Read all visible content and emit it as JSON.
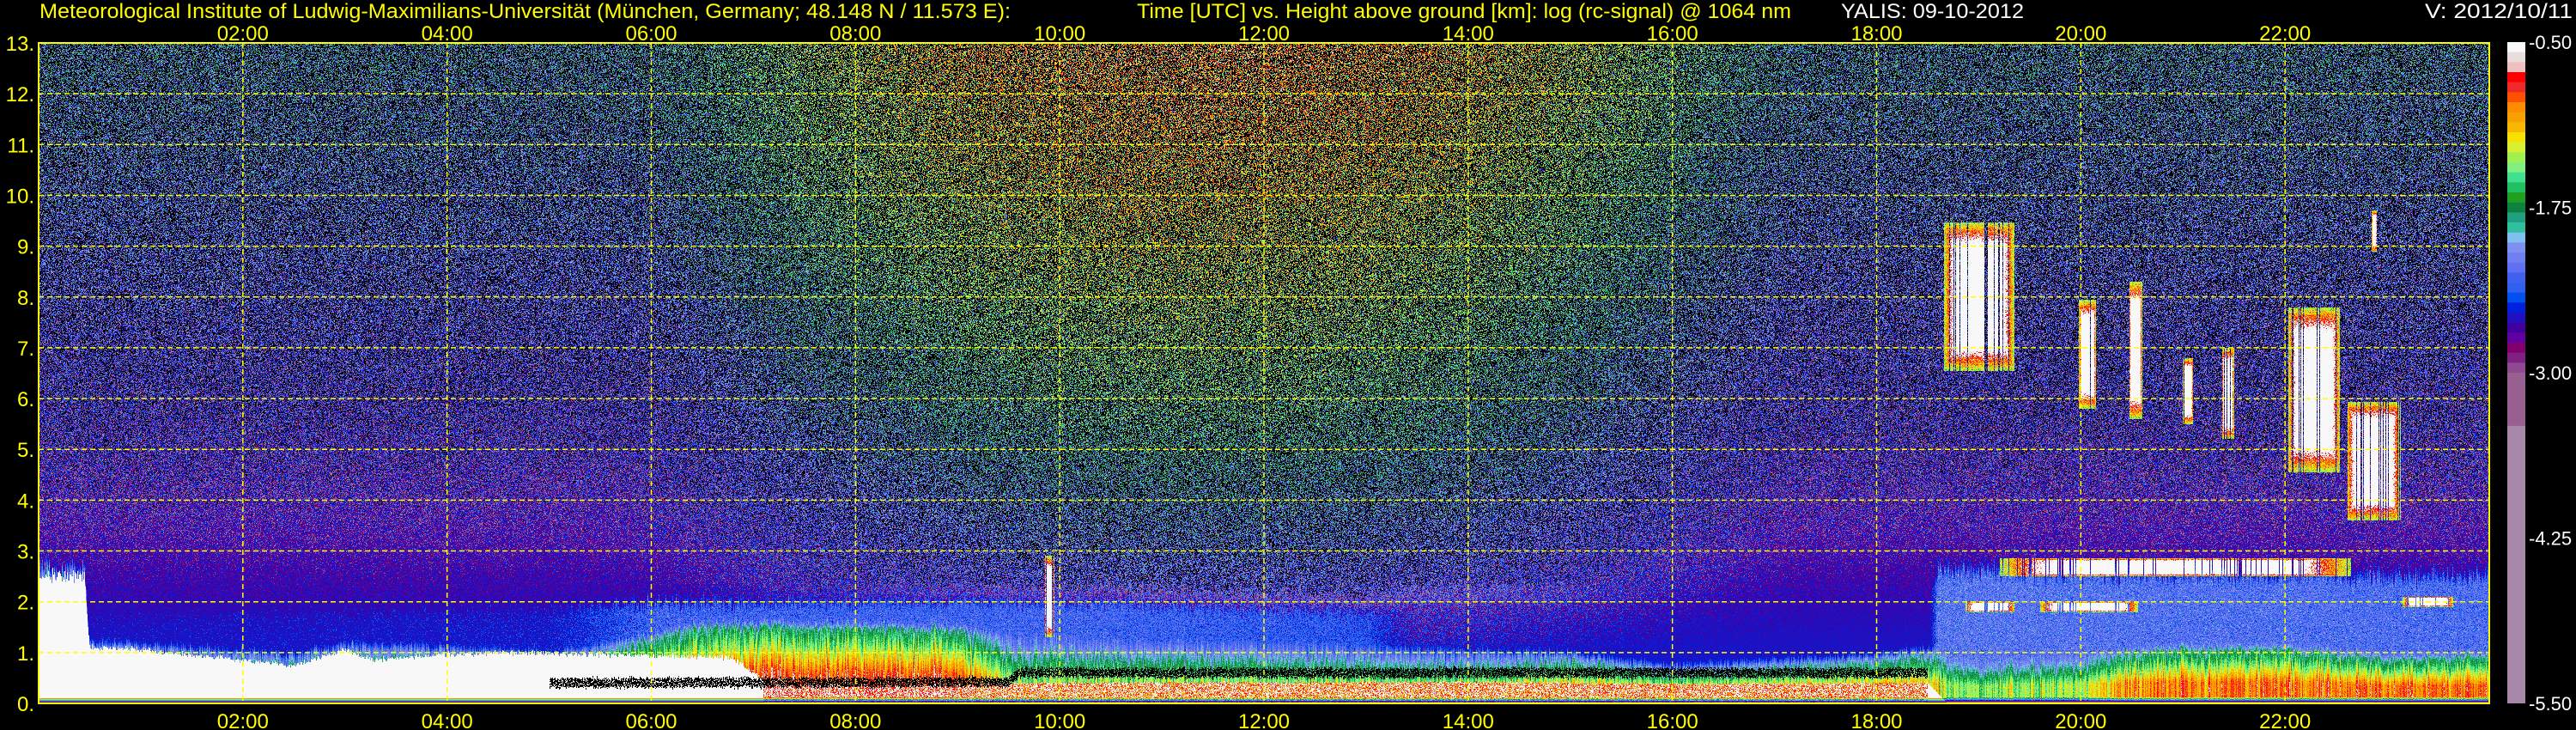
{
  "header": {
    "institute": "Meteorological Institute of Ludwig-Maximilians-Universität (München, Germany; 48.148 N / 11.573 E):",
    "title": "Time [UTC] vs. Height above ground [km]: log (rc-signal) @ 1064 nm",
    "instrument": "YALIS: 09-10-2012",
    "version": "V: 2012/10/11"
  },
  "colors": {
    "axis": "#ffff00",
    "grid": "#ffff00",
    "text_white": "#ffffff",
    "background": "#000000"
  },
  "chart_data": {
    "type": "heatmap",
    "title": "Time [UTC] vs. Height above ground [km]: log (rc-signal) @ 1064 nm",
    "xlabel": "Time [UTC]",
    "ylabel": "Height above ground [km]",
    "zlabel": "log (rc-signal)",
    "xlim": [
      0,
      24
    ],
    "ylim": [
      0,
      13
    ],
    "grid": true,
    "xticks": [
      2,
      4,
      6,
      8,
      10,
      12,
      14,
      16,
      18,
      20,
      22
    ],
    "xtick_labels": [
      "02:00",
      "04:00",
      "06:00",
      "08:00",
      "10:00",
      "12:00",
      "14:00",
      "16:00",
      "18:00",
      "20:00",
      "22:00"
    ],
    "yticks": [
      0,
      1,
      2,
      3,
      4,
      5,
      6,
      7,
      8,
      9,
      10,
      11,
      12,
      13
    ],
    "ytick_labels": [
      "0.",
      "1.",
      "2.",
      "3.",
      "4.",
      "5.",
      "6.",
      "7.",
      "8.",
      "9.",
      "10.",
      "11.",
      "12.",
      "13."
    ],
    "colorbar": {
      "range": [
        -5.5,
        -0.5
      ],
      "placement": "right",
      "ticks": [
        -0.5,
        -1.75,
        -3.0,
        -4.25,
        -5.5
      ],
      "tick_labels": [
        "-0.50",
        "-1.75",
        "-3.00",
        "-4.25",
        "-5.50"
      ],
      "colors": [
        "#f8f8f8",
        "#e8dcdc",
        "#f0c0c0",
        "#ff0000",
        "#f02828",
        "#ff5000",
        "#ff8c00",
        "#f8a000",
        "#f8b800",
        "#f8e000",
        "#d8f030",
        "#a0f050",
        "#80f080",
        "#40e090",
        "#20c060",
        "#20a020",
        "#108040",
        "#20a080",
        "#30c0a0",
        "#80c0f0",
        "#8090f0",
        "#7080f0",
        "#6070f0",
        "#4060f0",
        "#3060f0",
        "#0050f0",
        "#0020e0",
        "#2010c0",
        "#4000a0",
        "#6000a0",
        "#800070",
        "#802080",
        "#904890"
      ],
      "colors_range": [
        -3.0,
        -0.5
      ],
      "tail_bins": [
        {
          "color": "#986090",
          "range": [
            -3.4,
            -3.0
          ]
        },
        {
          "color": "#a888a8",
          "range": [
            -5.5,
            -3.4
          ]
        }
      ]
    },
    "features": {
      "fog_top_km": [
        [
          0,
          2.5
        ],
        [
          0.45,
          2.5
        ],
        [
          0.5,
          1.1
        ],
        [
          1.0,
          1.05
        ],
        [
          2.0,
          0.85
        ],
        [
          2.5,
          0.75
        ],
        [
          3.0,
          1.05
        ],
        [
          3.3,
          0.85
        ],
        [
          3.8,
          0.95
        ],
        [
          4.5,
          1.0
        ],
        [
          6.0,
          0.95
        ],
        [
          6.8,
          0.9
        ],
        [
          7.1,
          0.45
        ],
        [
          8,
          0.35
        ],
        [
          9.5,
          0.4
        ],
        [
          14,
          0.42
        ],
        [
          16,
          0.38
        ],
        [
          18.5,
          0.4
        ],
        [
          18.7,
          0.0
        ],
        [
          24,
          0.0
        ]
      ],
      "boundary_layer_top_km": [
        [
          0,
          2.6
        ],
        [
          0.45,
          2.6
        ],
        [
          0.5,
          1.15
        ],
        [
          1.0,
          1.1
        ],
        [
          2.0,
          0.95
        ],
        [
          2.5,
          0.9
        ],
        [
          3.0,
          1.1
        ],
        [
          4.0,
          1.05
        ],
        [
          5.0,
          0.95
        ],
        [
          5.5,
          1.1
        ],
        [
          6.0,
          1.25
        ],
        [
          6.5,
          1.5
        ],
        [
          7,
          1.45
        ],
        [
          8,
          1.45
        ],
        [
          9,
          1.4
        ],
        [
          10,
          1.3
        ],
        [
          11,
          1.2
        ],
        [
          12,
          1.2
        ],
        [
          13,
          1.1
        ],
        [
          14,
          1.0
        ],
        [
          15,
          0.9
        ],
        [
          16,
          0.65
        ],
        [
          17,
          0.75
        ],
        [
          18,
          0.85
        ],
        [
          18.6,
          1.0
        ],
        [
          19,
          0.85
        ],
        [
          20,
          0.95
        ],
        [
          21,
          1.05
        ],
        [
          22,
          1.05
        ],
        [
          23,
          0.85
        ],
        [
          24,
          0.9
        ]
      ],
      "boundary_layer_log_signal": [
        [
          0,
          -1.3
        ],
        [
          5.5,
          -1.3
        ],
        [
          6,
          -1.0
        ],
        [
          7,
          -0.85
        ],
        [
          9,
          -0.9
        ],
        [
          9.5,
          -1.45
        ],
        [
          14,
          -1.45
        ],
        [
          15,
          -1.2
        ],
        [
          16.5,
          -1.15
        ],
        [
          18.5,
          -1.1
        ],
        [
          18.7,
          -1.45
        ],
        [
          20,
          -1.35
        ],
        [
          20.5,
          -1.0
        ],
        [
          22,
          -0.95
        ],
        [
          24,
          -0.95
        ]
      ],
      "residual_layer": [
        [
          0,
          1.7,
          -2.7
        ],
        [
          5,
          1.8,
          -2.6
        ],
        [
          6,
          1.9,
          -2.3
        ],
        [
          10,
          1.9,
          -2.3
        ],
        [
          13,
          1.7,
          -2.4
        ],
        [
          13.5,
          1.9,
          -2.9
        ],
        [
          18.5,
          1.9,
          -2.9
        ],
        [
          18.6,
          2.5,
          -2.2
        ],
        [
          24,
          2.4,
          -2.25
        ]
      ],
      "dark_band": {
        "time_h": [
          5.0,
          18.5
        ],
        "height_km": [
          [
            5,
            0.4
          ],
          [
            9.5,
            0.42
          ],
          [
            9.6,
            0.6
          ],
          [
            18.5,
            0.6
          ]
        ]
      },
      "clouds": [
        {
          "time_h": [
            18.66,
            19.35
          ],
          "height_km": [
            6.55,
            9.47
          ]
        },
        {
          "time_h": [
            19.98,
            20.15
          ],
          "height_km": [
            5.8,
            7.94
          ]
        },
        {
          "time_h": [
            20.47,
            20.6
          ],
          "height_km": [
            5.6,
            8.3
          ]
        },
        {
          "time_h": [
            21.0,
            21.1
          ],
          "height_km": [
            5.5,
            6.8
          ]
        },
        {
          "time_h": [
            21.38,
            21.5
          ],
          "height_km": [
            5.2,
            7.0
          ]
        },
        {
          "time_h": [
            22.03,
            22.54
          ],
          "height_km": [
            4.55,
            7.8
          ]
        },
        {
          "time_h": [
            22.6,
            23.13
          ],
          "height_km": [
            3.6,
            5.94
          ]
        },
        {
          "time_h": [
            22.85,
            22.9
          ],
          "height_km": [
            8.9,
            9.7
          ]
        },
        {
          "time_h": [
            19.2,
            22.65
          ],
          "height_km": [
            2.5,
            2.86
          ]
        },
        {
          "time_h": [
            18.87,
            19.35
          ],
          "height_km": [
            1.8,
            2.0
          ]
        },
        {
          "time_h": [
            19.6,
            20.56
          ],
          "height_km": [
            1.8,
            2.0
          ]
        },
        {
          "time_h": [
            23.15,
            23.65
          ],
          "height_km": [
            1.9,
            2.1
          ]
        },
        {
          "time_h": [
            9.85,
            9.95
          ],
          "height_km": [
            1.3,
            2.9
          ]
        }
      ]
    }
  }
}
